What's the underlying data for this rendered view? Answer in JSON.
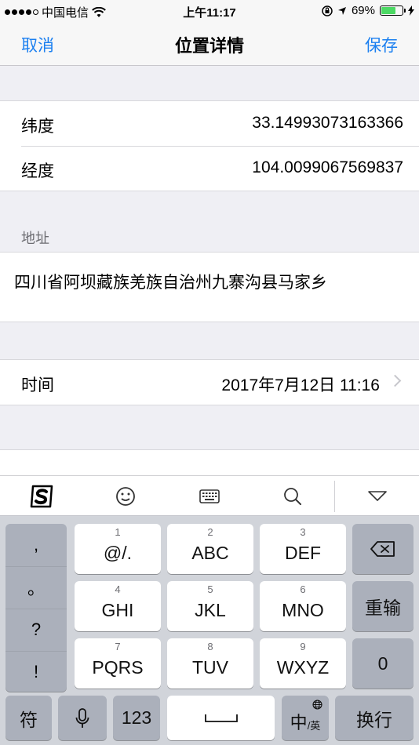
{
  "status_bar": {
    "carrier": "中国电信",
    "time": "上午11:17",
    "battery_percent": "69%",
    "battery_level": 0.69,
    "signal_bars_filled": 4,
    "signal_bars_total": 5
  },
  "nav": {
    "cancel": "取消",
    "title": "位置详情",
    "save": "保存"
  },
  "coords": {
    "lat_label": "纬度",
    "lat_value": "33.14993073163366",
    "lng_label": "经度",
    "lng_value": "104.0099067569837"
  },
  "address": {
    "header": "地址",
    "value": "四川省阿坝藏族羌族自治州九寨沟县马家乡"
  },
  "time_row": {
    "label": "时间",
    "value": "2017年7月12日 11:16"
  },
  "keyboard": {
    "punct": [
      ",",
      "。",
      "?",
      "!"
    ],
    "keys": [
      {
        "num": "1",
        "label": "@/."
      },
      {
        "num": "2",
        "label": "ABC"
      },
      {
        "num": "3",
        "label": "DEF"
      },
      {
        "num": "4",
        "label": "GHI"
      },
      {
        "num": "5",
        "label": "JKL"
      },
      {
        "num": "6",
        "label": "MNO"
      },
      {
        "num": "7",
        "label": "PQRS"
      },
      {
        "num": "8",
        "label": "TUV"
      },
      {
        "num": "9",
        "label": "WXYZ"
      }
    ],
    "retype": "重输",
    "zero": "0",
    "symbols": "符",
    "num123": "123",
    "lang_main": "中",
    "lang_sub": "/英",
    "return": "换行"
  },
  "colors": {
    "accent": "#1a7ff0",
    "battery": "#4cd964"
  }
}
